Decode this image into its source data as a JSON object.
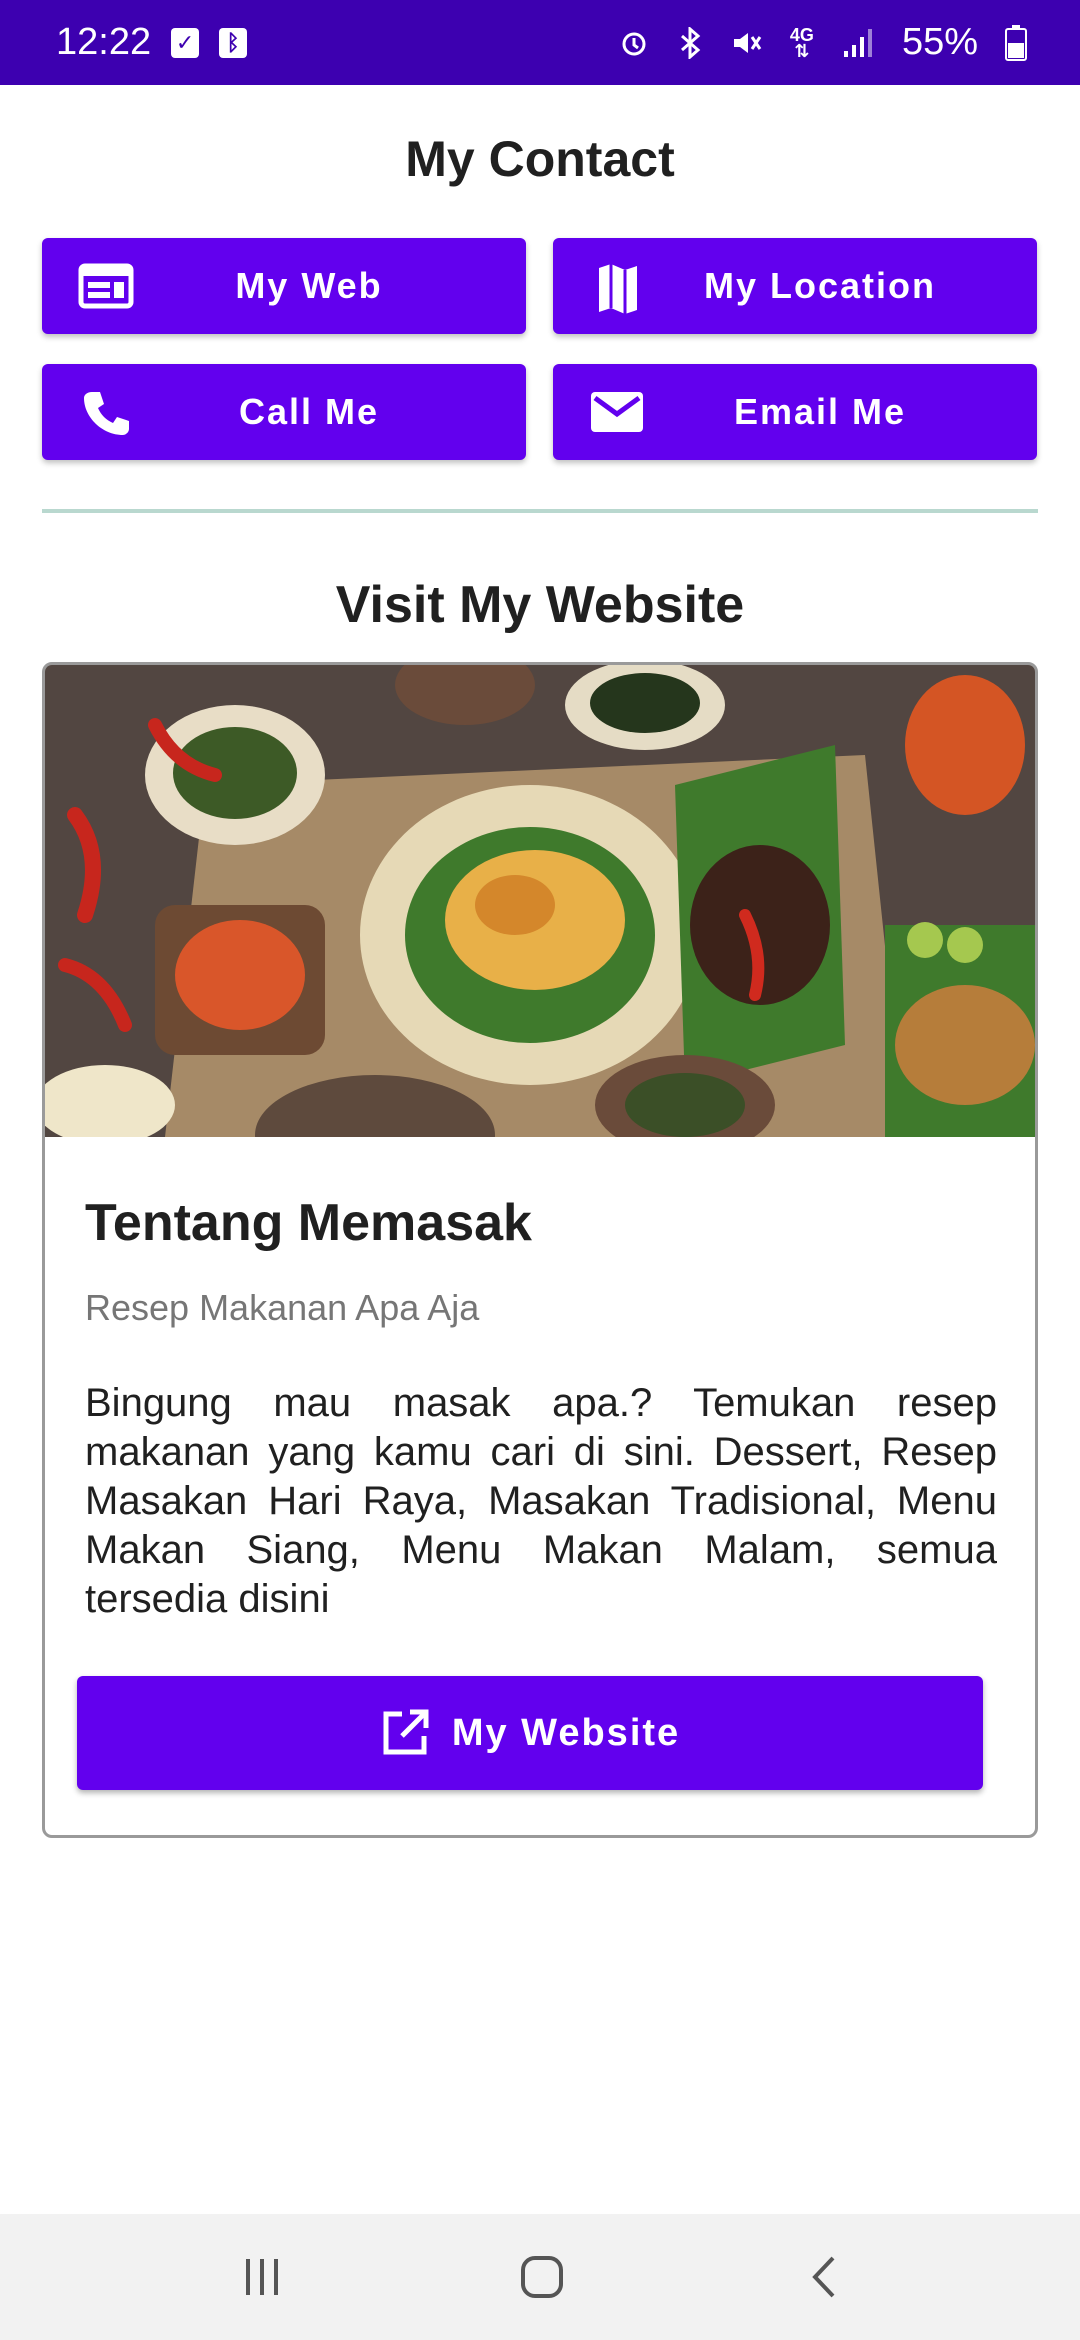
{
  "status_bar": {
    "time": "12:22",
    "battery": "55%",
    "network_label": "4G",
    "icons": [
      "check-box-icon",
      "bluetooth-icon",
      "alarm-icon",
      "bluetooth-icon",
      "mute-icon",
      "signal-icon",
      "battery-icon"
    ]
  },
  "contact": {
    "title": "My Contact",
    "buttons": [
      {
        "label": "My Web",
        "icon": "web-icon"
      },
      {
        "label": "My Location",
        "icon": "map-icon"
      },
      {
        "label": "Call Me",
        "icon": "phone-icon"
      },
      {
        "label": "Email Me",
        "icon": "email-icon"
      }
    ]
  },
  "website": {
    "title": "Visit My Website",
    "card": {
      "image": "food-photo",
      "title": "Tentang Memasak",
      "subtitle": "Resep Makanan Apa Aja",
      "body": "Bingung mau masak apa.? Temukan resep makanan yang kamu cari di sini. Dessert, Resep Masakan Hari Raya, Masakan Tradisional, Menu Makan Siang, Menu Makan Malam, semua tersedia disini",
      "button_label": "My Website"
    }
  },
  "colors": {
    "status_bar": "#3d00b0",
    "primary": "#6200ee",
    "divider": "#b9d8cf"
  },
  "nav": [
    "recent-apps-icon",
    "home-icon",
    "back-icon"
  ]
}
